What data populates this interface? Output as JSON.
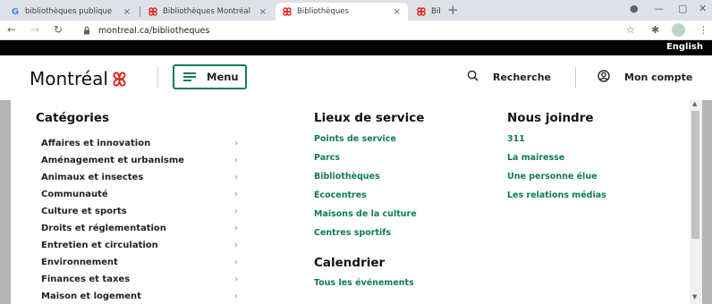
{
  "browser": {
    "tabs": [
      {
        "label": "bibliothèques publique",
        "favicon": "google-g-icon",
        "active": false
      },
      {
        "label": "Bibliothèques Montréal",
        "favicon": "montreal-rose-icon",
        "active": false
      },
      {
        "label": "Bibliothèques",
        "favicon": "montreal-rose-icon",
        "active": true
      },
      {
        "label": "Bibliothèques publique",
        "favicon": "montreal-rose-icon",
        "active": false
      }
    ],
    "url": "montreal.ca/bibliotheques"
  },
  "site": {
    "lang_link": "English",
    "logo_text": "Montréal",
    "menu_label": "Menu",
    "search_label": "Recherche",
    "account_label": "Mon compte",
    "accent_color": "#0f7a5f",
    "brand_red": "#e2231a"
  },
  "categories": {
    "title": "Catégories",
    "items": [
      "Affaires et innovation",
      "Aménagement et urbanisme",
      "Animaux et insectes",
      "Communauté",
      "Culture et sports",
      "Droits et réglementation",
      "Entretien et circulation",
      "Environnement",
      "Finances et taxes",
      "Maison et logement"
    ]
  },
  "lieux": {
    "title": "Lieux de service",
    "items": [
      "Points de service",
      "Parcs",
      "Bibliothèques",
      "Écocentres",
      "Maisons de la culture",
      "Centres sportifs"
    ]
  },
  "calendrier": {
    "title": "Calendrier",
    "items": [
      "Tous les événements"
    ]
  },
  "nous_joindre": {
    "title": "Nous joindre",
    "items": [
      "311",
      "La mairesse",
      "Une personne élue",
      "Les relations médias"
    ]
  }
}
